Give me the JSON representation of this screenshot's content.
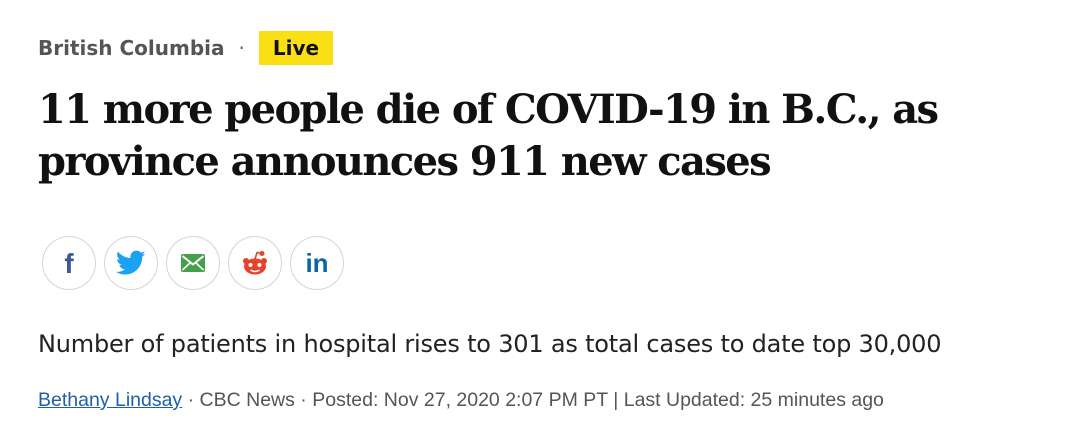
{
  "kicker": {
    "section": "British Columbia",
    "separator": "·",
    "live_label": "Live"
  },
  "headline": "11 more people die of COVID-19 in B.C., as province announces 911 new cases",
  "share": {
    "facebook_icon": "facebook-icon",
    "twitter_icon": "twitter-icon",
    "email_icon": "email-icon",
    "reddit_icon": "reddit-icon",
    "linkedin_icon": "linkedin-icon",
    "facebook_glyph": "f",
    "linkedin_glyph": "in",
    "colors": {
      "facebook": "#3b5998",
      "twitter": "#1da1f2",
      "email": "#44a04a",
      "reddit": "#e8422b",
      "linkedin": "#0a66a7"
    }
  },
  "deck": "Number of patients in hospital rises to 301 as total cases to date top 30,000",
  "byline": {
    "author": "Bethany Lindsay",
    "sep1": " · ",
    "source": "CBC News",
    "sep2": " · ",
    "posted": "Posted: Nov 27, 2020 2:07 PM PT",
    "sep3": " | ",
    "updated": "Last Updated: 25 minutes ago"
  }
}
